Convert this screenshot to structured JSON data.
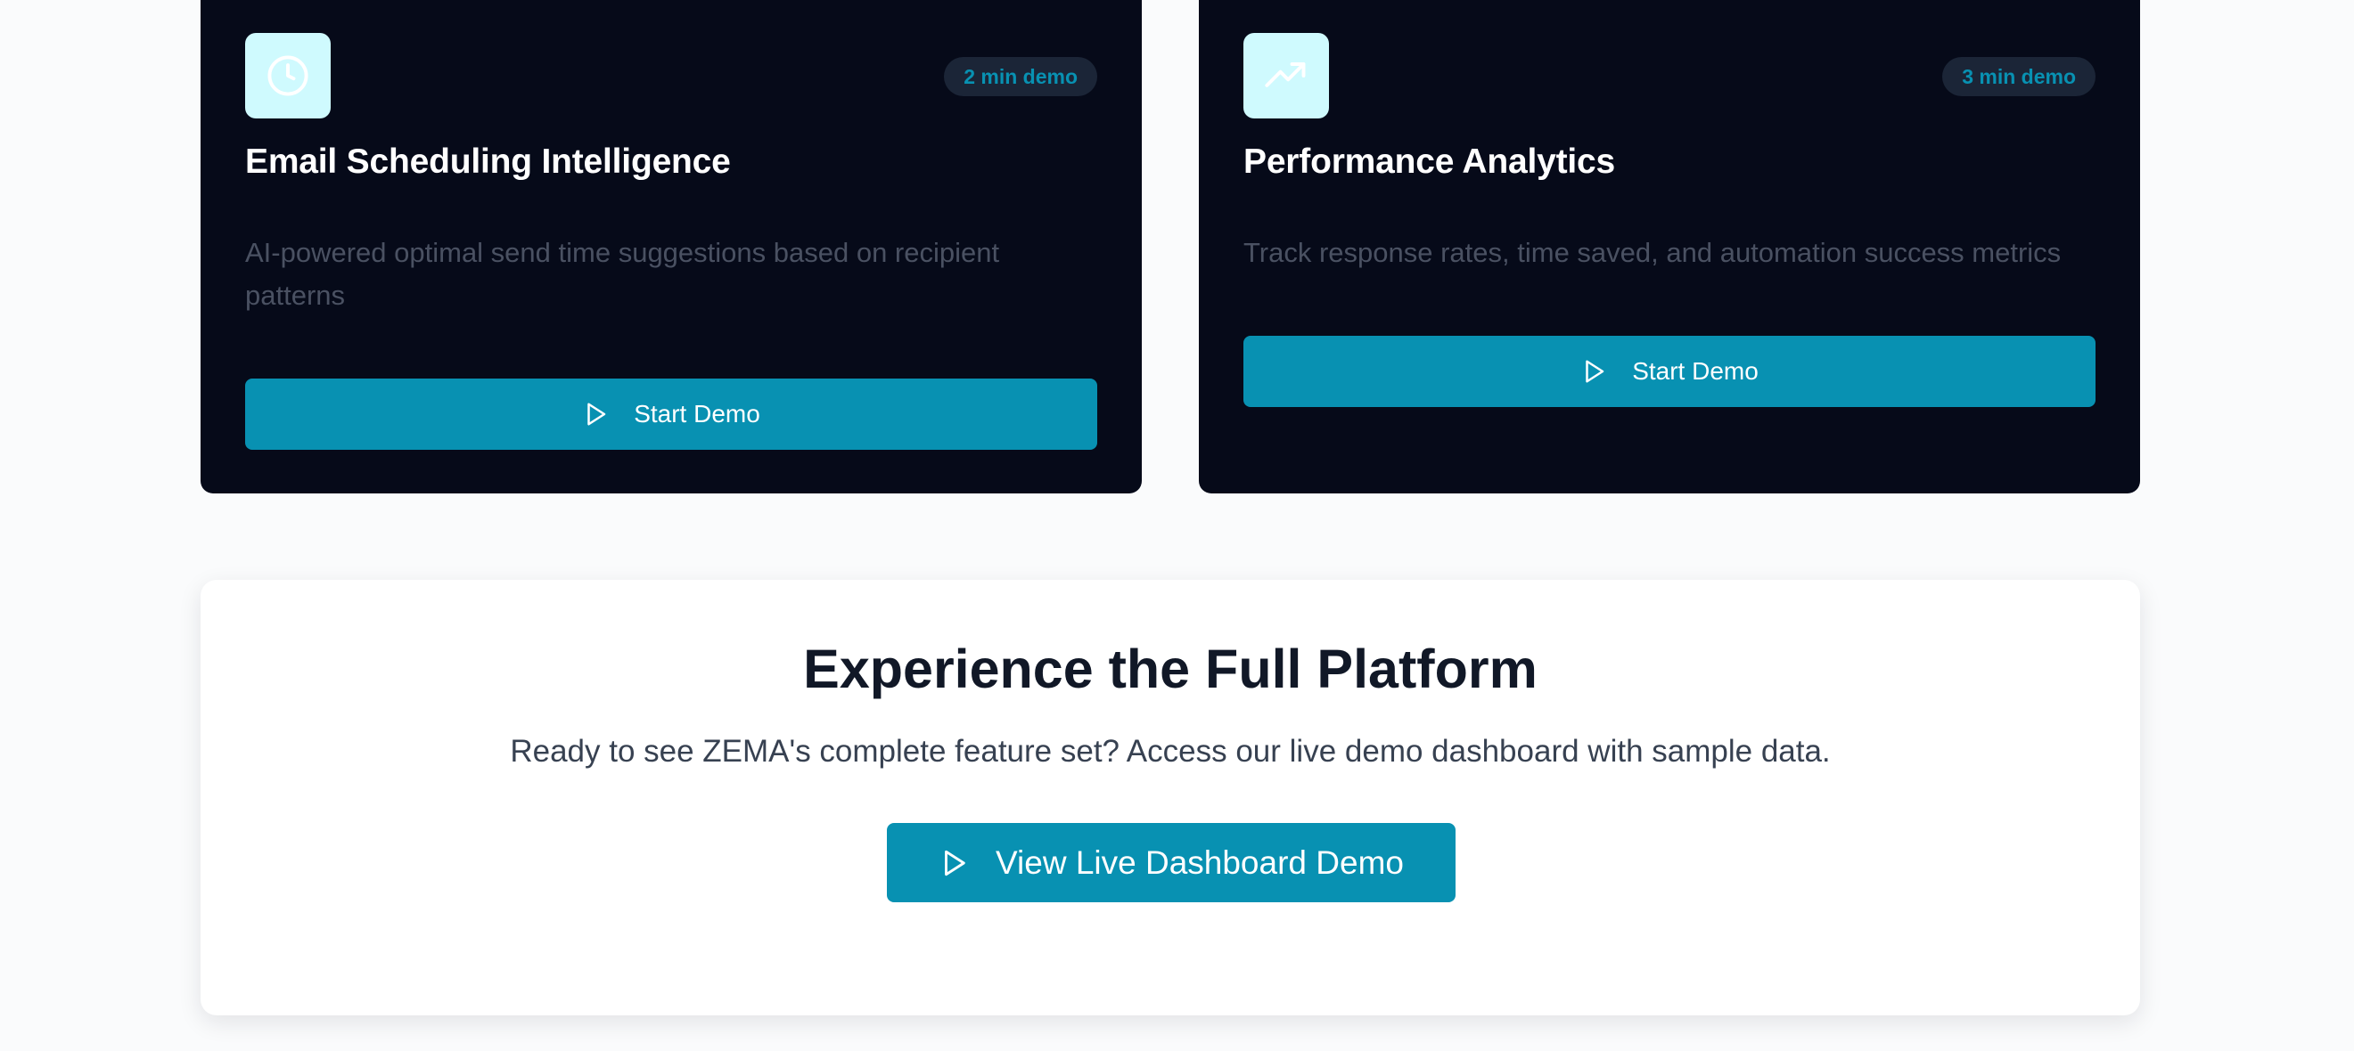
{
  "demo_cards": [
    {
      "icon": "clock-icon",
      "badge": "2 min demo",
      "title": "Email Scheduling Intelligence",
      "description": "AI-powered optimal send time suggestions based on recipient patterns",
      "button_label": "Start Demo"
    },
    {
      "icon": "trending-up-icon",
      "badge": "3 min demo",
      "title": "Performance Analytics",
      "description": "Track response rates, time saved, and automation success metrics",
      "button_label": "Start Demo"
    }
  ],
  "cta": {
    "title": "Experience the Full Platform",
    "subtitle": "Ready to see ZEMA's complete feature set? Access our live demo dashboard with sample data.",
    "button_label": "View Live Dashboard Demo"
  },
  "colors": {
    "accent": "#0891b2",
    "card_bg": "#060a19",
    "icon_bg": "#cffafe",
    "page_bg": "#fafbfc"
  }
}
